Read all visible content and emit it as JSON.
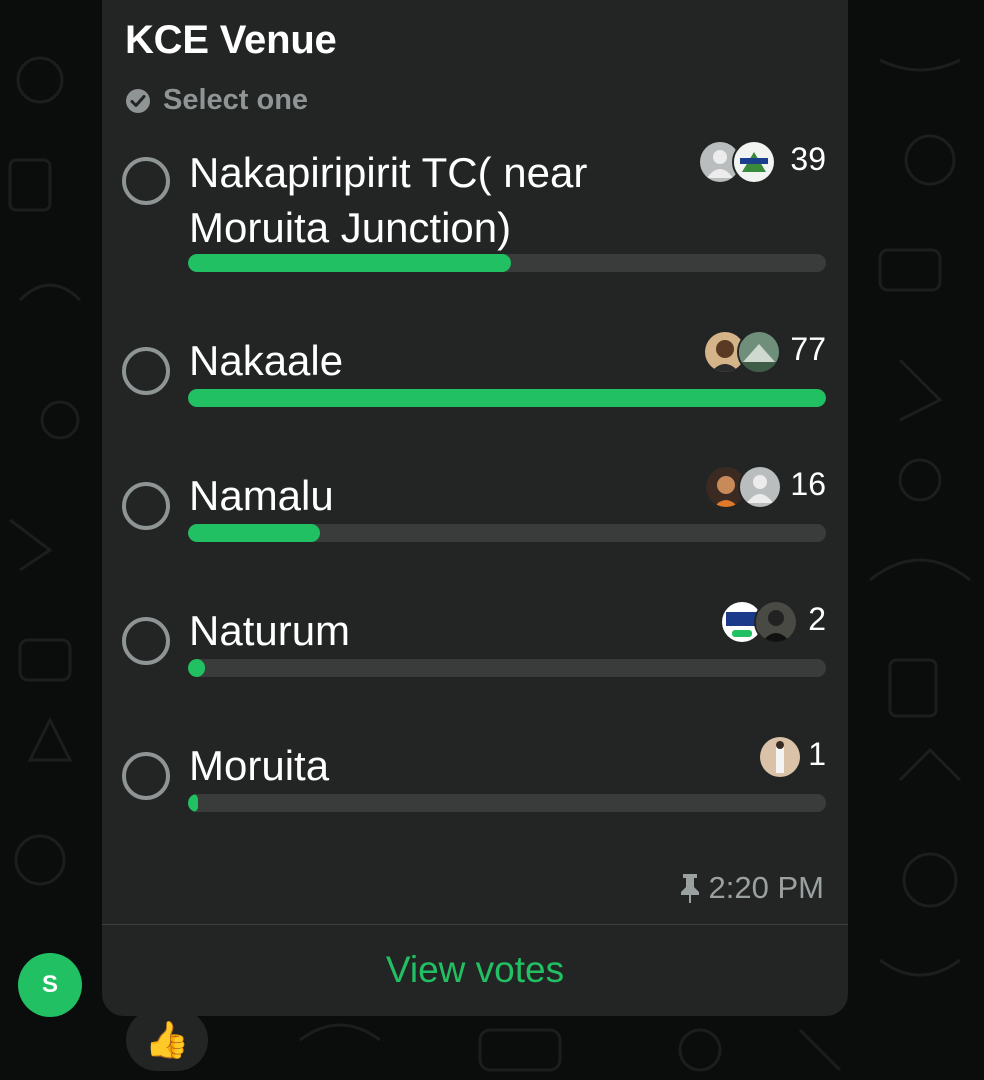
{
  "poll": {
    "title": "KCE Venue",
    "hint": "Select one",
    "options": [
      {
        "label": "Nakapiripirit TC( near Moruita Junction)",
        "votes": "39",
        "fraction": 0.506
      },
      {
        "label": "Nakaale",
        "votes": "77",
        "fraction": 1.0
      },
      {
        "label": "Namalu",
        "votes": "16",
        "fraction": 0.207
      },
      {
        "label": "Naturum",
        "votes": "2",
        "fraction": 0.026
      },
      {
        "label": "Moruita",
        "votes": "1",
        "fraction": 0.013
      }
    ],
    "time": "2:20 PM",
    "view_votes_label": "View votes"
  },
  "sender": {
    "initial": "S"
  },
  "reaction": {
    "emoji": "👍"
  },
  "colors": {
    "accent": "#21c063",
    "bubble": "#232525",
    "background": "#0b0c0c"
  },
  "icons": [
    "check-circle-icon",
    "pin-icon",
    "default-avatar-icon"
  ]
}
